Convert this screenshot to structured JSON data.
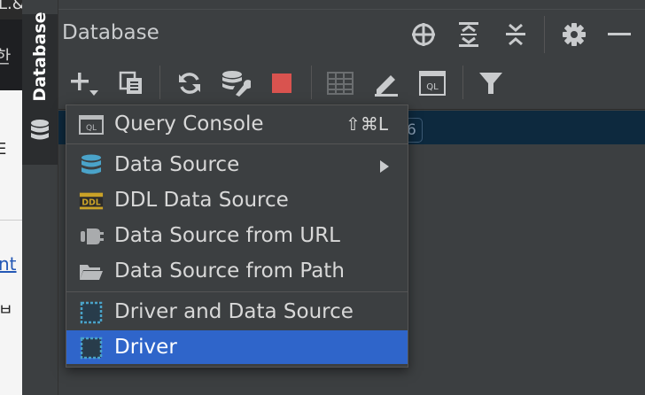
{
  "background_app": {
    "fragments": [
      "L.&",
      "한",
      "E",
      "nt",
      "ㅂ"
    ]
  },
  "stripe": {
    "label": "Database"
  },
  "panel": {
    "title": "Database",
    "header_icons": [
      "crosshair-icon",
      "expand-all-icon",
      "collapse-all-icon",
      "gear-icon",
      "minimize-icon"
    ],
    "toolbar_icons": [
      "add-icon",
      "copy-icon",
      "refresh-icon",
      "schema-settings-icon",
      "stop-icon",
      "table-icon",
      "edit-icon",
      "ql-console-icon",
      "filter-icon"
    ]
  },
  "tree": {
    "badge": "6"
  },
  "menu": {
    "items": [
      {
        "label": "Query Console",
        "shortcut": "⇧⌘L",
        "icon": "ql-console-icon"
      },
      {
        "label": "Data Source",
        "icon": "database-icon",
        "submenu": true
      },
      {
        "label": "DDL Data Source",
        "icon": "ddl-icon"
      },
      {
        "label": "Data Source from URL",
        "icon": "plug-icon"
      },
      {
        "label": "Data Source from Path",
        "icon": "folder-icon"
      },
      {
        "label": "Driver and Data Source",
        "icon": "driver-icon"
      },
      {
        "label": "Driver",
        "icon": "driver-icon",
        "selected": true
      }
    ]
  },
  "colors": {
    "panel_bg": "#3c3f41",
    "selection": "#2f65ca",
    "tree_selection": "#0d293e",
    "stop_red": "#d9534f",
    "db_blue": "#4aa3c9"
  }
}
